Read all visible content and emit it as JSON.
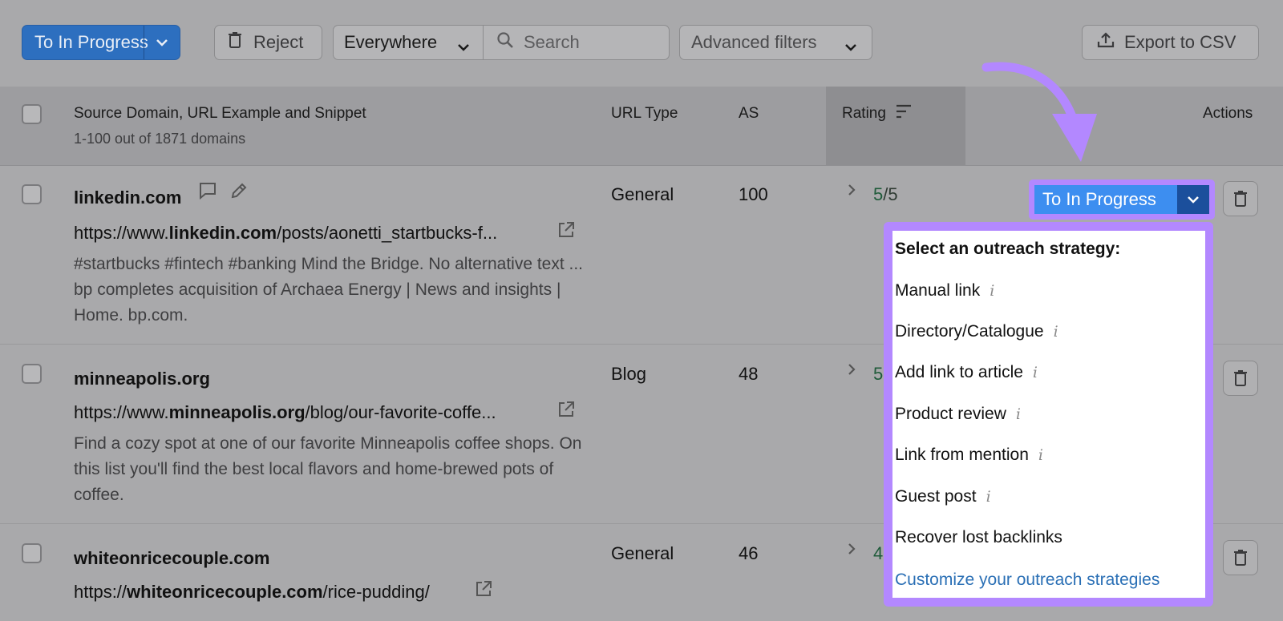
{
  "toolbar": {
    "primary_action": "To In Progress",
    "reject": "Reject",
    "scope": "Everywhere",
    "search_placeholder": "Search",
    "advanced_filters": "Advanced filters",
    "export": "Export to CSV"
  },
  "table": {
    "columns": {
      "source": "Source Domain, URL Example and Snippet",
      "source_sub": "1-100 out of 1871 domains",
      "url_type": "URL Type",
      "as": "AS",
      "rating": "Rating",
      "actions": "Actions"
    },
    "rows": [
      {
        "domain": "linkedin.com",
        "url_prefix": "https://www.",
        "url_domain": "linkedin.com",
        "url_suffix": "/posts/aonetti_startbucks-f...",
        "snippet": "#startbucks #fintech #banking Mind the Bridge. No alternative text ... bp completes acquisition of Archaea Energy | News and insights | Home. bp.com.",
        "url_type": "General",
        "as": "100",
        "rating": "5",
        "rating_max": "/5"
      },
      {
        "domain": "minneapolis.org",
        "url_prefix": "https://www.",
        "url_domain": "minneapolis.org",
        "url_suffix": "/blog/our-favorite-coffe...",
        "snippet": "Find a cozy spot at one of our favorite Minneapolis coffee shops. On this list you'll find the best local flavors and home-brewed pots of coffee.",
        "url_type": "Blog",
        "as": "48",
        "rating": "5"
      },
      {
        "domain": "whiteonricecouple.com",
        "url_prefix": "https://",
        "url_domain": "whiteonricecouple.com",
        "url_suffix": "/rice-pudding/",
        "url_type": "General",
        "as": "46",
        "rating": "4"
      }
    ]
  },
  "status_button": {
    "label": "To In Progress"
  },
  "dropdown": {
    "heading": "Select an outreach strategy:",
    "items": [
      "Manual link",
      "Directory/Catalogue",
      "Add link to article",
      "Product review",
      "Link from mention",
      "Guest post",
      "Recover lost backlinks"
    ],
    "info_glyph": "i",
    "footer_link": "Customize your outreach strategies"
  },
  "colors": {
    "highlight": "#b388ff",
    "primary": "#3d8ef0",
    "link": "#2a6fb5",
    "rating": "#1f5b3a"
  }
}
